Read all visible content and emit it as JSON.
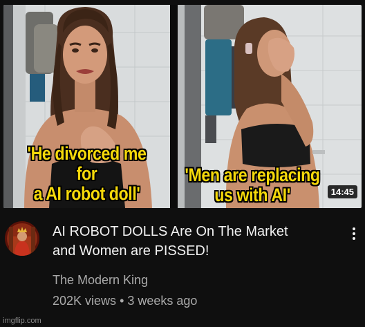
{
  "thumbnail": {
    "caption_left_line1": "'He divorced me for",
    "caption_left_line2": "a AI robot doll'",
    "caption_right_line1": "'Men are replacing",
    "caption_right_line2": "us with AI'",
    "duration": "14:45",
    "caption_color": "#f5d90a"
  },
  "video": {
    "title_line1": "AI ROBOT DOLLS Are On The Market",
    "title_line2": "and Women are PISSED!",
    "channel": "The Modern King",
    "views": "202K views",
    "separator": "•",
    "age": "3 weeks ago"
  },
  "icons": {
    "more": "more-vertical-icon"
  },
  "watermark": "imgflip.com",
  "colors": {
    "background": "#0f0f0f",
    "title": "#f1f1f1",
    "secondary_text": "#aaaaaa"
  }
}
